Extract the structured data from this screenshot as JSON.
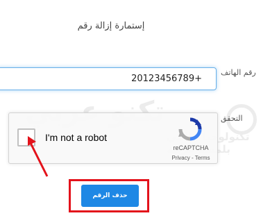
{
  "form": {
    "title": "إستمارة إزالة رقم",
    "phone_label": "رقم الهاتف",
    "phone_value": "+20123456789",
    "verify_label": "التحقق",
    "delete_button": "حذف الرقم"
  },
  "recaptcha": {
    "label": "I'm not a robot",
    "brand": "reCAPTCHA",
    "privacy": "Privacy",
    "separator": " - ",
    "terms": "Terms"
  },
  "watermark": {
    "main": "تكنو عربي",
    "sub": "تكنولوجيا عالمي بلمسة عربية"
  },
  "colors": {
    "accent": "#1e88e5",
    "highlight": "#e3121b",
    "input_focus": "#66afe9"
  }
}
